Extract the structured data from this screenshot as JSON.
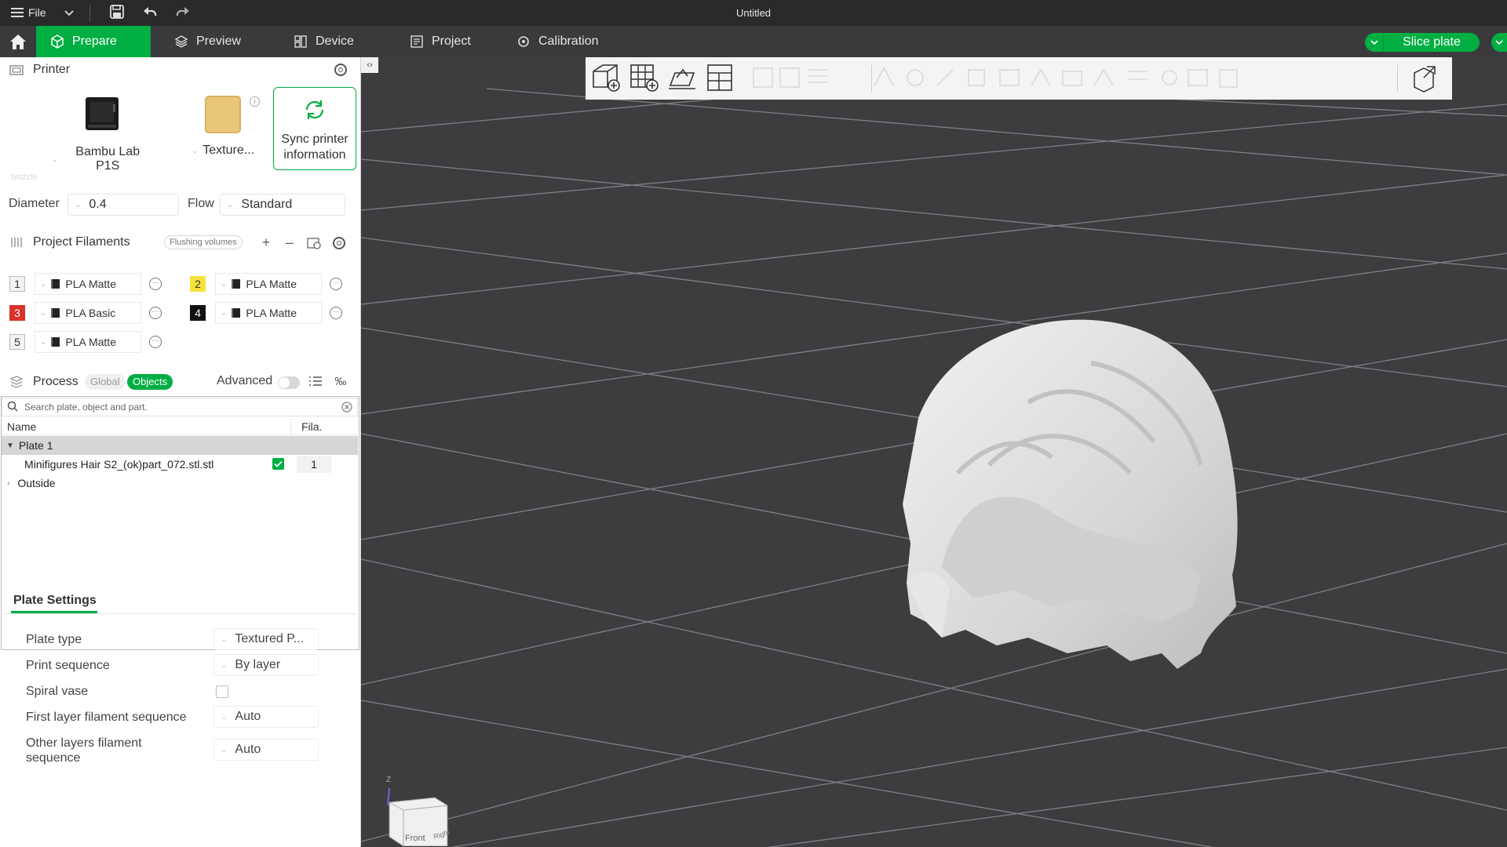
{
  "titlebar": {
    "file_label": "File",
    "title": "Untitled"
  },
  "nav": {
    "tabs": [
      {
        "label": "Prepare"
      },
      {
        "label": "Preview"
      },
      {
        "label": "Device"
      },
      {
        "label": "Project"
      },
      {
        "label": "Calibration"
      }
    ],
    "slice_label": "Slice plate"
  },
  "printer": {
    "section_title": "Printer",
    "printer_name": "Bambu Lab P1S",
    "plate_name": "Texture...",
    "sync_label_1": "Sync printer",
    "sync_label_2": "information",
    "ghost_label": "Nozzle",
    "diameter_label": "Diameter",
    "diameter_value": "0.4",
    "flow_label": "Flow",
    "flow_value": "Standard"
  },
  "filaments": {
    "section_title": "Project Filaments",
    "flushing_label": "Flushing volumes",
    "items": [
      {
        "num": "1",
        "name": "PLA Matte",
        "color": "#f2f2f2",
        "text_color": "#333333"
      },
      {
        "num": "2",
        "name": "PLA Matte",
        "color": "#f5e23a",
        "text_color": "#333333"
      },
      {
        "num": "3",
        "name": "PLA Basic",
        "color": "#d9322b",
        "text_color": "#ffffff"
      },
      {
        "num": "4",
        "name": "PLA Matte",
        "color": "#111111",
        "text_color": "#ffffff"
      },
      {
        "num": "5",
        "name": "PLA Matte",
        "color": "#f2f2f2",
        "text_color": "#333333"
      }
    ]
  },
  "process": {
    "section_title": "Process",
    "global_label": "Global",
    "objects_label": "Objects",
    "advanced_label": "Advanced",
    "search_placeholder": "Search plate, object and part.",
    "col_name": "Name",
    "col_fila": "Fila.",
    "plate_row": "Plate 1",
    "object_row": "Minifigures Hair S2_(ok)part_072.stl.stl",
    "object_fila": "1",
    "outside_row": "Outside"
  },
  "plate_settings": {
    "tab_title": "Plate Settings",
    "plate_type_label": "Plate type",
    "plate_type_value": "Textured P...",
    "print_sequence_label": "Print sequence",
    "print_sequence_value": "By layer",
    "spiral_label": "Spiral vase",
    "first_layer_label": "First layer filament sequence",
    "first_layer_value": "Auto",
    "other_layers_label_1": "Other layers filament",
    "other_layers_label_2": "sequence",
    "other_layers_value": "Auto"
  },
  "viewport": {
    "cube_front": "Front",
    "cube_right": "Right",
    "axis_z": "Z"
  },
  "colors": {
    "accent": "#00ae42",
    "viewport_bg": "#3d3d40",
    "titlebar_bg": "#2a2a2c"
  }
}
